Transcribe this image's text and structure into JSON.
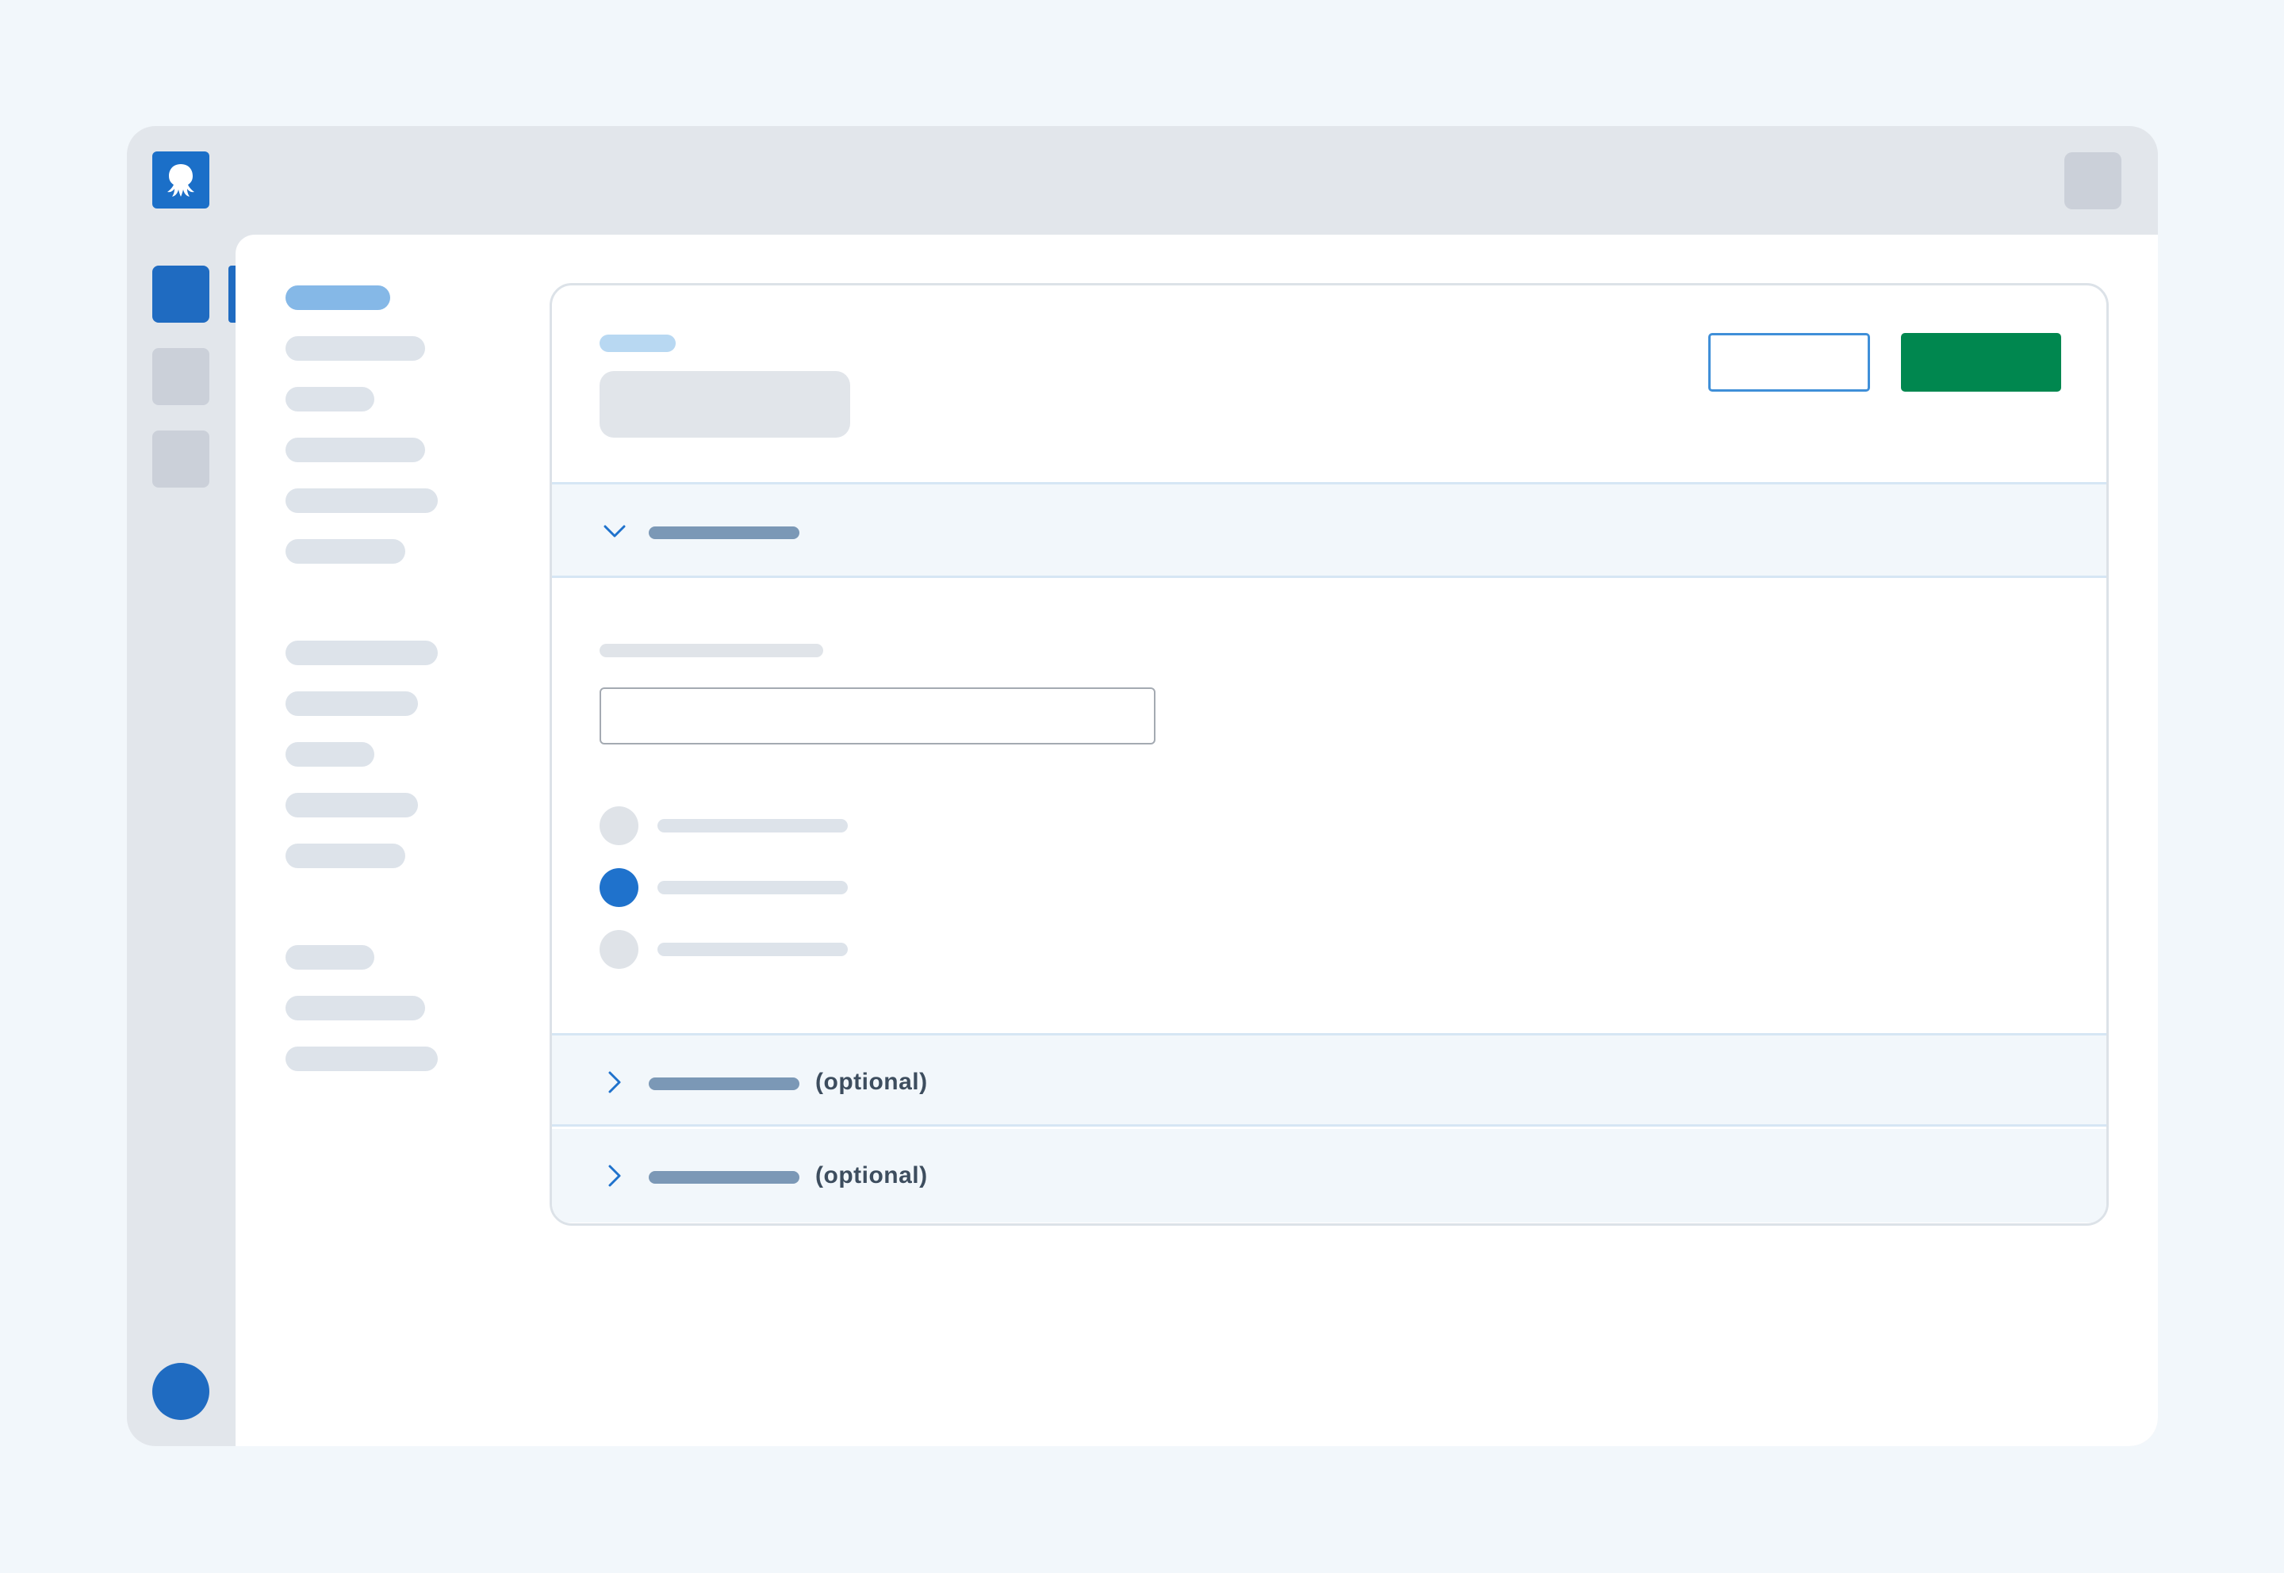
{
  "app": {
    "logo_icon": "octopus-logo-icon",
    "accent_color": "#1B6FC8",
    "primary_button_color": "#00874F"
  },
  "nav_rail": {
    "items": [
      {
        "icon": "nav-item-1",
        "active": true
      },
      {
        "icon": "nav-item-2",
        "active": false
      },
      {
        "icon": "nav-item-3",
        "active": false
      }
    ]
  },
  "form": {
    "sections": [
      {
        "state": "expanded",
        "icon": "chevron-down-icon",
        "tag": ""
      },
      {
        "state": "collapsed",
        "icon": "chevron-right-icon",
        "tag": "(optional)"
      },
      {
        "state": "collapsed",
        "icon": "chevron-right-icon",
        "tag": "(optional)"
      }
    ],
    "text_input": {
      "value": "",
      "placeholder": ""
    },
    "radio_options": [
      {
        "checked": false
      },
      {
        "checked": true
      },
      {
        "checked": false
      }
    ]
  }
}
